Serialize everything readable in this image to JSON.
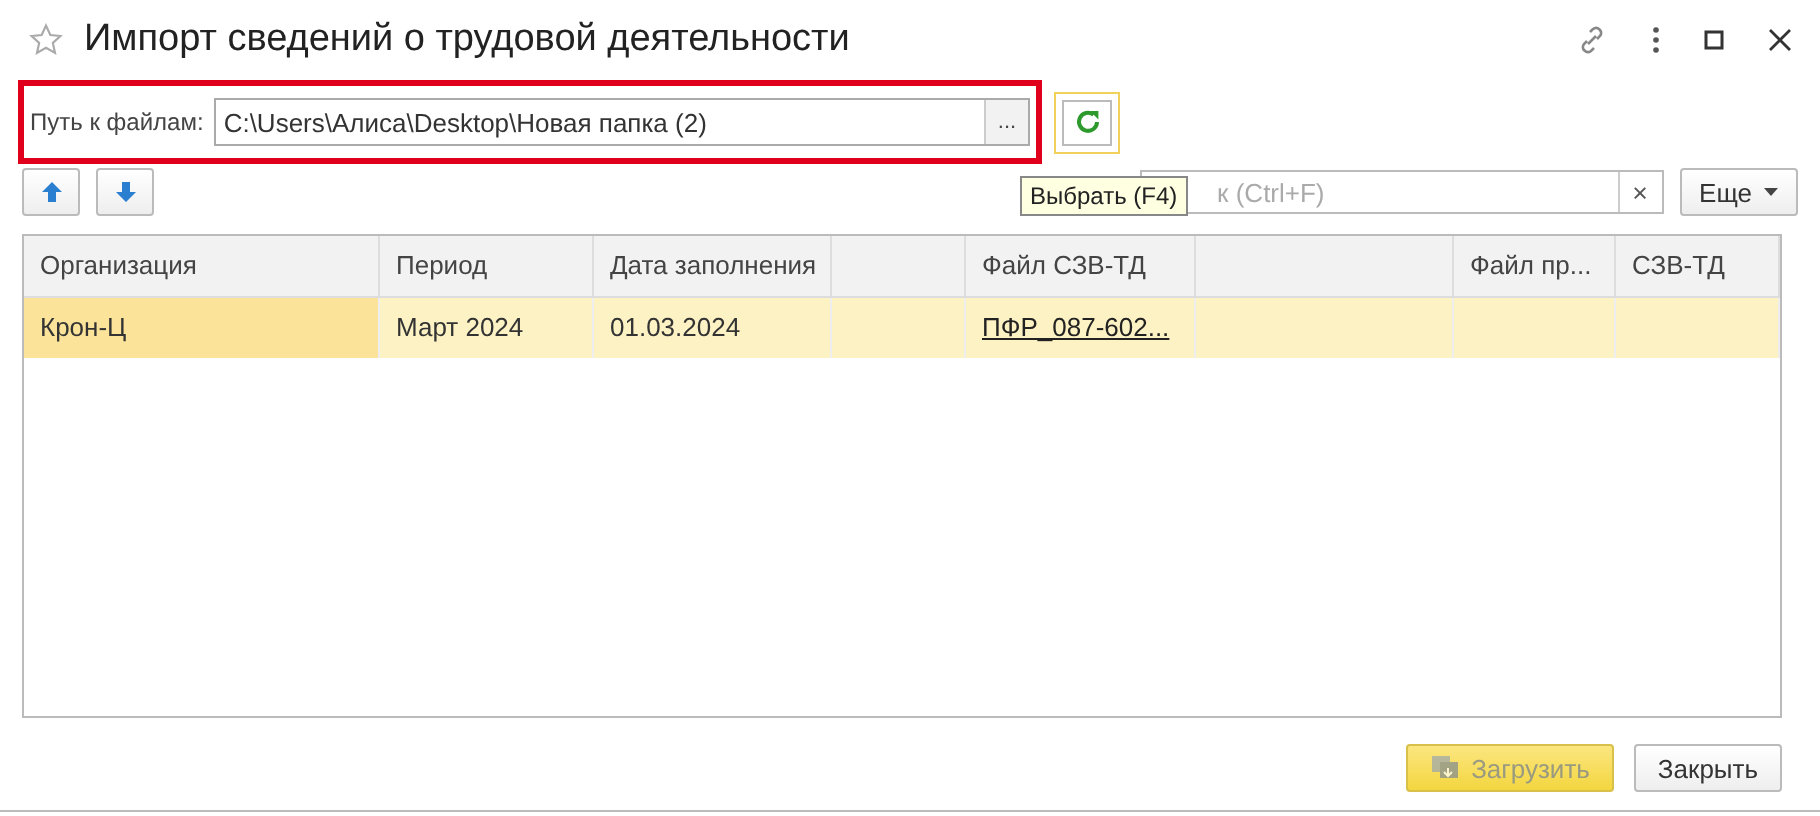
{
  "window": {
    "title": "Импорт сведений о трудовой деятельности",
    "favorite": false
  },
  "path": {
    "label": "Путь к файлам:",
    "value": "C:\\Users\\Алиса\\Desktop\\Новая папка (2)",
    "browse": "...",
    "highlighted": true
  },
  "search": {
    "placeholder": "к (Ctrl+F)",
    "clear": "×"
  },
  "tooltip": "Выбрать (F4)",
  "more_button": "Еще",
  "table": {
    "columns": [
      "Организация",
      "Период",
      "Дата заполнения",
      "",
      "Файл СЗВ-ТД",
      "",
      "Файл пр...",
      "СЗВ-ТД"
    ],
    "rows": [
      {
        "selected": true,
        "cells": [
          "Крон-Ц",
          "Март 2024",
          "01.03.2024",
          "",
          "ПФР_087-602...",
          "",
          "",
          ""
        ]
      }
    ]
  },
  "buttons": [
    {
      "label": "Загрузить",
      "kind": "primary",
      "disabled": true
    },
    {
      "label": "Закрыть",
      "kind": "plain",
      "disabled": false
    }
  ]
}
